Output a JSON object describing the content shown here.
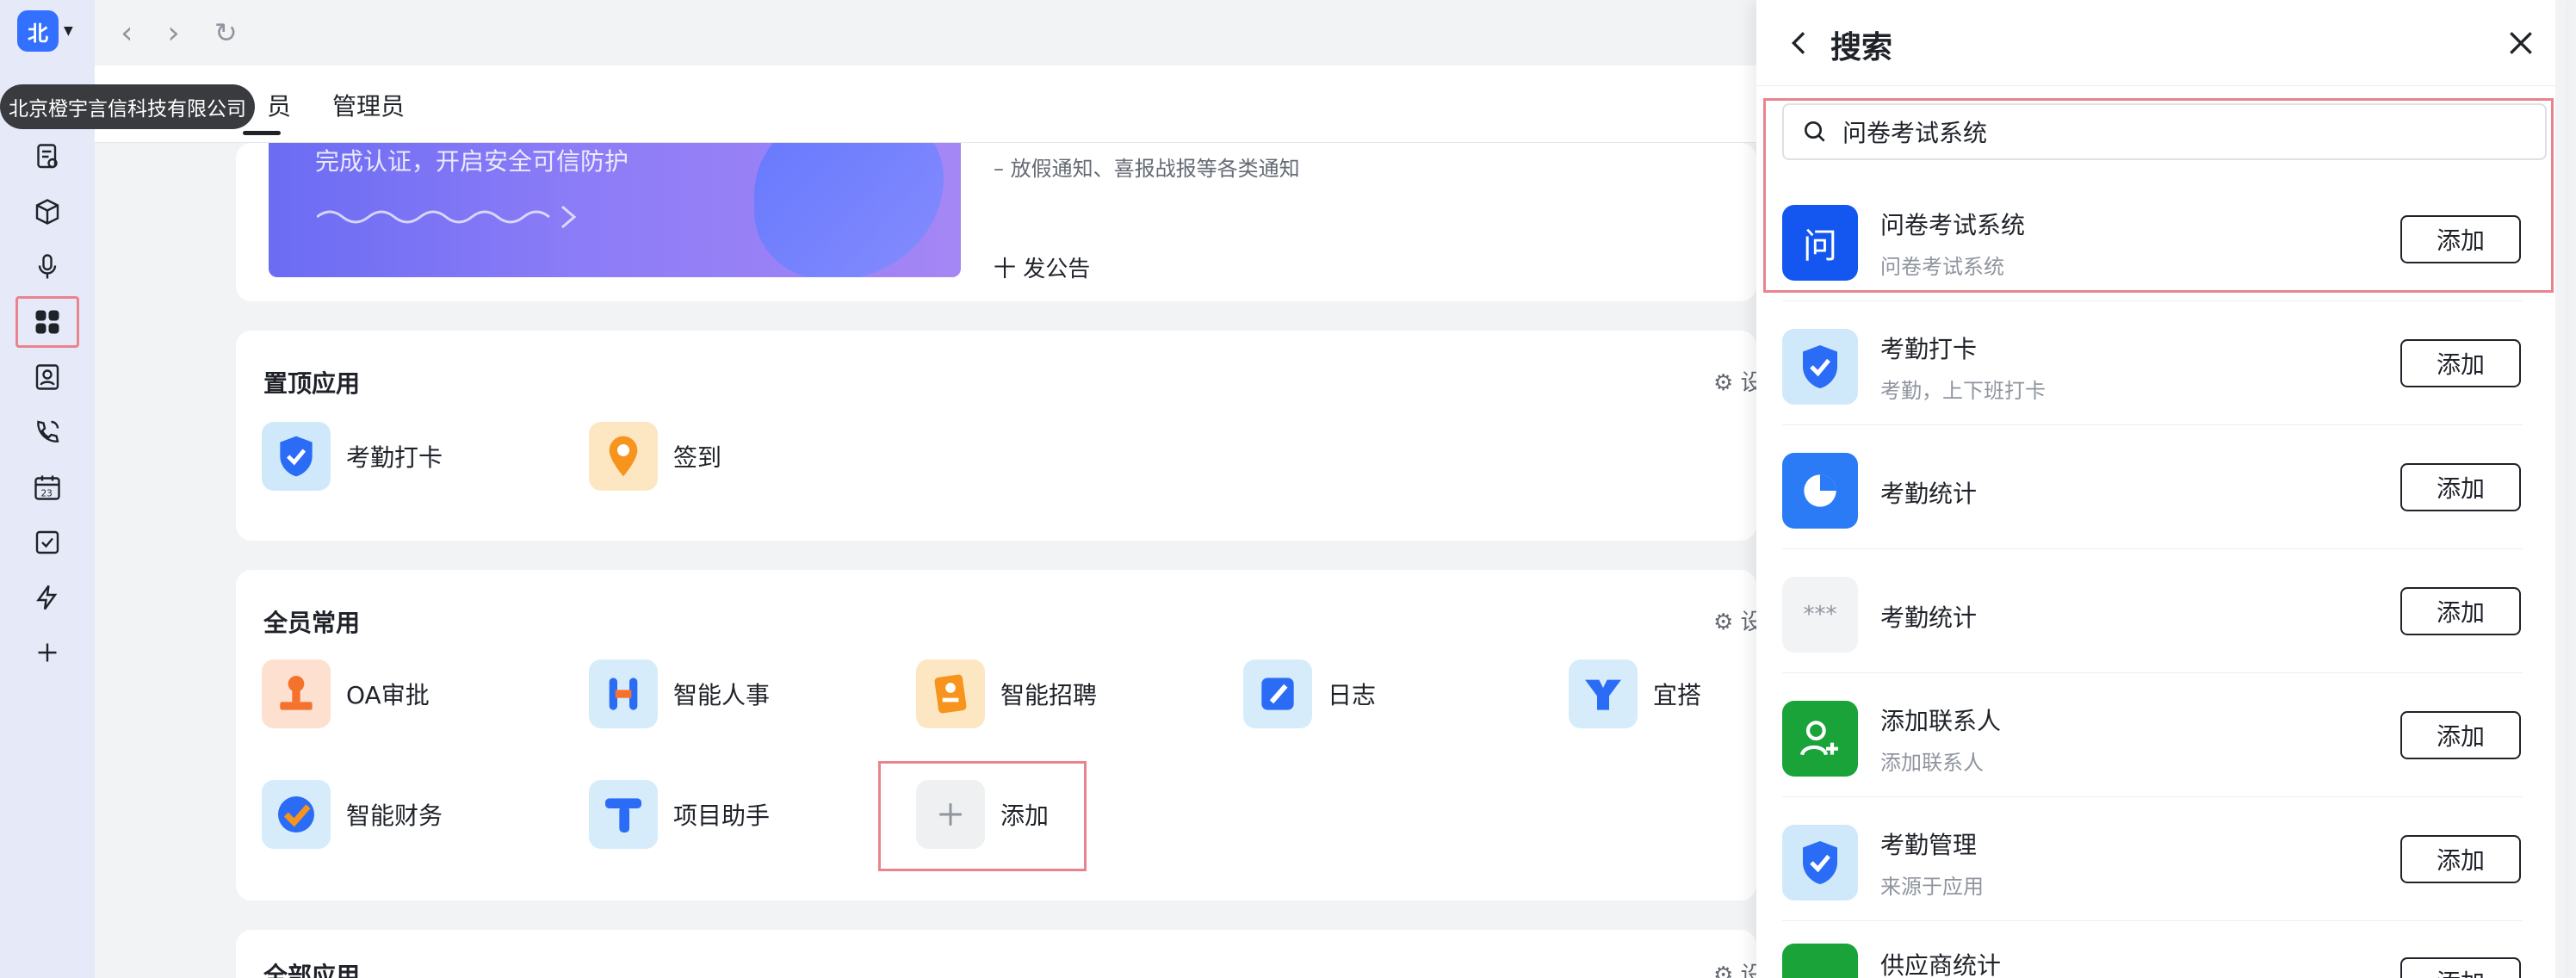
{
  "org": {
    "avatar_char": "北",
    "name_tooltip": "北京橙宇言信科技有限公司"
  },
  "tabs": [
    {
      "label": "员"
    },
    {
      "label": "管理员"
    }
  ],
  "banner": {
    "text": "完成认证，开启安全可信防护"
  },
  "announcement": {
    "line": "– 放假通知、喜报战报等各类通知",
    "post_label": "十 发公告"
  },
  "pinned": {
    "title": "置顶应用",
    "settings": "设",
    "apps": [
      {
        "label": "考勤打卡"
      },
      {
        "label": "签到"
      }
    ]
  },
  "common": {
    "title": "全员常用",
    "settings": "设",
    "apps": [
      {
        "label": "OA审批"
      },
      {
        "label": "智能人事"
      },
      {
        "label": "智能招聘"
      },
      {
        "label": "日志"
      },
      {
        "label": "宜搭"
      },
      {
        "label": "智能财务"
      },
      {
        "label": "项目助手"
      },
      {
        "label": "添加"
      }
    ]
  },
  "all_apps": {
    "title": "全部应用",
    "settings": "设"
  },
  "drawer": {
    "title": "搜索",
    "search_value": "问卷考试系统",
    "add_label": "添加",
    "results": [
      {
        "title": "问卷考试系统",
        "subtitle": "问卷考试系统",
        "icon_char": "问"
      },
      {
        "title": "考勤打卡",
        "subtitle": "考勤，上下班打卡"
      },
      {
        "title": "考勤统计",
        "subtitle": ""
      },
      {
        "title": "考勤统计",
        "subtitle": "",
        "icon_char": "***"
      },
      {
        "title": "添加联系人",
        "subtitle": "添加联系人"
      },
      {
        "title": "考勤管理",
        "subtitle": "来源于应用"
      },
      {
        "title": "供应商统计",
        "subtitle": ""
      }
    ]
  },
  "colors": {
    "brand_blue": "#3370ff",
    "highlight_red": "#e9848f",
    "rail_bg": "#e6e9f7"
  }
}
